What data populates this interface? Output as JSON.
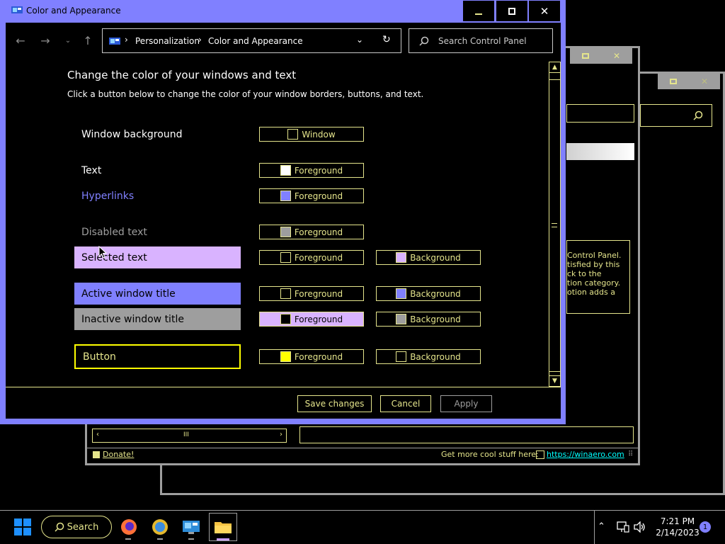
{
  "window": {
    "title": "Color and Appearance",
    "minimize": "▁",
    "maximize": "□",
    "close": "✕"
  },
  "address": {
    "crumbs": [
      "Personalization",
      "Color and Appearance"
    ],
    "separator": "›"
  },
  "search": {
    "placeholder": "Search Control Panel"
  },
  "content": {
    "heading": "Change the color of your windows and text",
    "subheading": "Click a button below to change the color of your window borders, buttons, and text."
  },
  "rows": [
    {
      "label": "Window background",
      "fg_btn": "Window"
    },
    {
      "label": "Text",
      "fg_btn": "Foreground"
    },
    {
      "label": "Hyperlinks",
      "fg_btn": "Foreground"
    },
    {
      "label": "Disabled text",
      "fg_btn": "Foreground"
    },
    {
      "label": "Selected text",
      "fg_btn": "Foreground",
      "bg_btn": "Background"
    },
    {
      "label": "Active window title",
      "fg_btn": "Foreground",
      "bg_btn": "Background"
    },
    {
      "label": "Inactive window title",
      "fg_btn": "Foreground",
      "bg_btn": "Background"
    },
    {
      "label": "Button",
      "fg_btn": "Foreground",
      "bg_btn": "Background"
    }
  ],
  "actions": {
    "save": "Save changes",
    "cancel": "Cancel",
    "apply": "Apply"
  },
  "bg_window": {
    "info_lines": [
      "Control Panel.",
      "tisfied by this",
      "ck to the",
      "tion category.",
      "otion adds a"
    ],
    "donate": "Donate!",
    "more_text": "Get more cool stuff here:",
    "site": "https://winaero.com"
  },
  "taskbar": {
    "search_label": "Search",
    "time": "7:21 PM",
    "date": "2/14/2023",
    "notification_count": "1"
  },
  "colors": {
    "accent": "#8080ff",
    "text_yellow": "#e5e58c",
    "selected_bg": "#d9b3ff",
    "disabled_gray": "#9e9e9e",
    "button_yellow": "#ffff00"
  }
}
